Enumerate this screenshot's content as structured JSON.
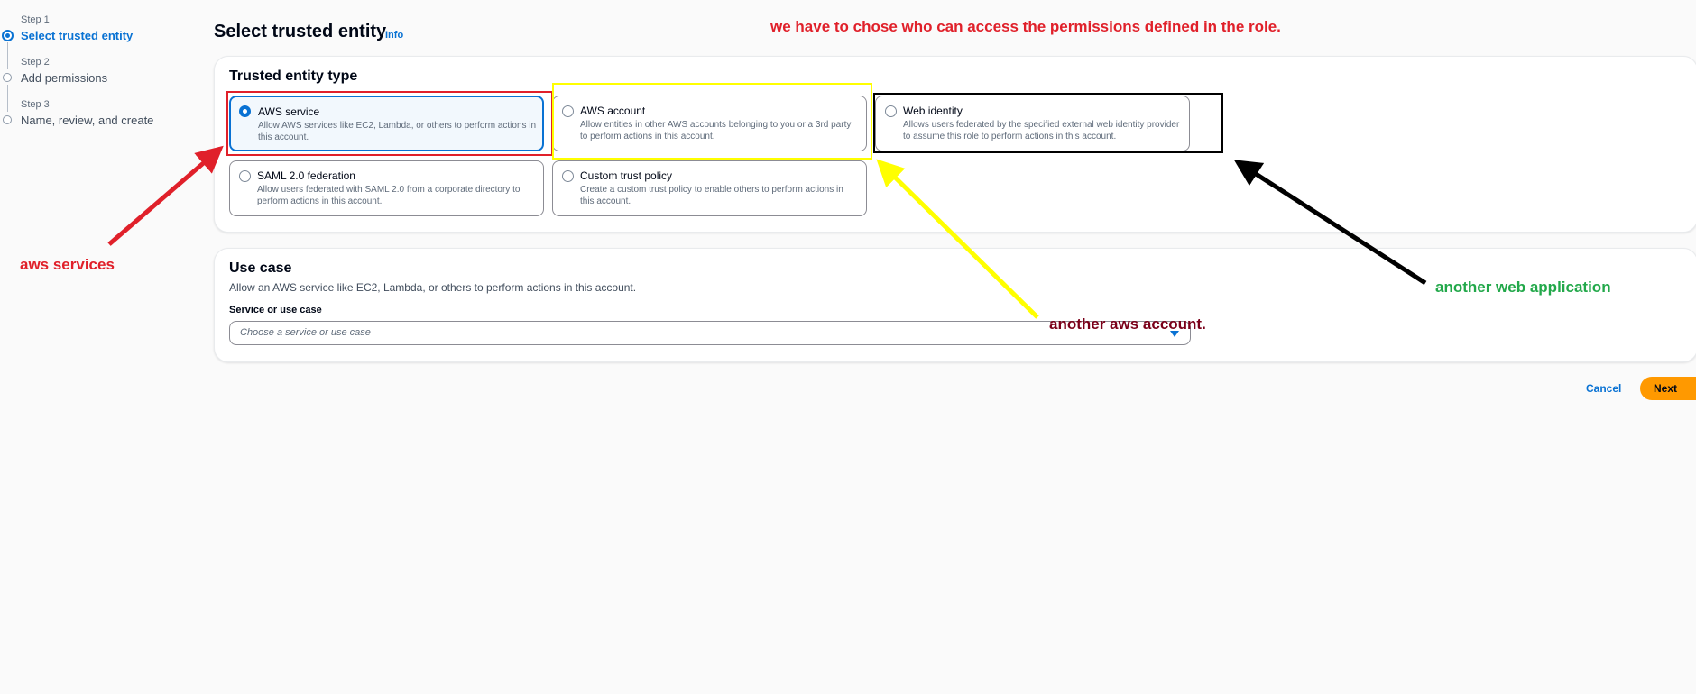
{
  "steps": [
    {
      "number": "Step 1",
      "label": "Select trusted entity",
      "active": true
    },
    {
      "number": "Step 2",
      "label": "Add permissions",
      "active": false
    },
    {
      "number": "Step 3",
      "label": "Name, review, and create",
      "active": false
    }
  ],
  "header": {
    "title": "Select trusted entity",
    "info": "Info"
  },
  "trusted_entity": {
    "title": "Trusted entity type",
    "options": [
      {
        "title": "AWS service",
        "description": "Allow AWS services like EC2, Lambda, or others to perform actions in this account.",
        "selected": true
      },
      {
        "title": "AWS account",
        "description": "Allow entities in other AWS accounts belonging to you or a 3rd party to perform actions in this account.",
        "selected": false
      },
      {
        "title": "Web identity",
        "description": "Allows users federated by the specified external web identity provider to assume this role to perform actions in this account.",
        "selected": false
      },
      {
        "title": "SAML 2.0 federation",
        "description": "Allow users federated with SAML 2.0 from a corporate directory to perform actions in this account.",
        "selected": false
      },
      {
        "title": "Custom trust policy",
        "description": "Create a custom trust policy to enable others to perform actions in this account.",
        "selected": false
      }
    ]
  },
  "use_case": {
    "title": "Use case",
    "description": "Allow an AWS service like EC2, Lambda, or others to perform actions in this account.",
    "field_label": "Service or use case",
    "placeholder": "Choose a service or use case"
  },
  "actions": {
    "cancel": "Cancel",
    "next": "Next"
  },
  "annotations": {
    "top_note": "we have to chose who can access the permissions defined in the role.",
    "aws_services": "aws services",
    "another_account": "another aws account.",
    "another_web_app": "another web application"
  },
  "colors": {
    "accent": "#0972d3",
    "primary_button": "#ff9900",
    "annotation_red": "#e0202a",
    "annotation_yellow": "#ffff00",
    "annotation_black": "#000000",
    "annotation_green": "#22a84a",
    "annotation_maroon": "#7a0019"
  }
}
